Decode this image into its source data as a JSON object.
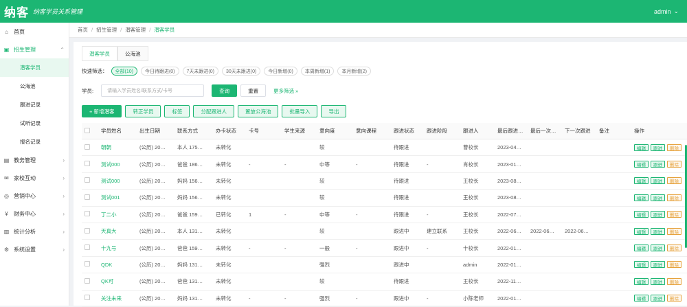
{
  "header": {
    "logo": "纳客",
    "slogan": "纳客学员关系管理",
    "user": "admin"
  },
  "sidebar": {
    "items": [
      {
        "label": "首页",
        "icon": "home-icon",
        "glyph": "⌂"
      },
      {
        "label": "招生管理",
        "icon": "enroll-icon",
        "glyph": "▣",
        "expanded": true,
        "children": [
          "潜客学员",
          "公海池",
          "跟进记录",
          "试听记录",
          "报名记录"
        ]
      },
      {
        "label": "教务管理",
        "icon": "book-icon",
        "glyph": "▤"
      },
      {
        "label": "家校互动",
        "icon": "chat-icon",
        "glyph": "✉"
      },
      {
        "label": "营销中心",
        "icon": "marketing-icon",
        "glyph": "◎"
      },
      {
        "label": "财务中心",
        "icon": "finance-icon",
        "glyph": "¥"
      },
      {
        "label": "统计分析",
        "icon": "chart-icon",
        "glyph": "▥"
      },
      {
        "label": "系统设置",
        "icon": "settings-icon",
        "glyph": "⚙"
      }
    ]
  },
  "breadcrumb": [
    "首页",
    "招生管理",
    "潜客管理",
    "潜客学员"
  ],
  "tabs": [
    "潜客学员",
    "公海池"
  ],
  "filter": {
    "label": "快速筛选：",
    "chips": [
      "全部(10)",
      "今日待跟进(0)",
      "7天未跟进(0)",
      "30天未跟进(0)",
      "今日新增(0)",
      "本周新增(1)",
      "本月新增(2)"
    ]
  },
  "search": {
    "label": "学员:",
    "placeholder": "请输入学员姓名/联系方式/卡号",
    "query_button": "查询",
    "reset_button": "重置",
    "more_link": "更多筛选 »"
  },
  "actions": [
    "+ 新增潜客",
    "转正学员",
    "标签",
    "分配跟进人",
    "置放公海池",
    "批量导入",
    "导出"
  ],
  "table": {
    "columns": [
      "学员姓名",
      "出生日期",
      "联系方式",
      "办卡状态",
      "卡号",
      "学生来源",
      "意向度",
      "意向课程",
      "跟进状态",
      "跟进阶段",
      "跟进人",
      "最后跟进…",
      "最后一次…",
      "下一次跟进",
      "备注",
      "操作"
    ],
    "ops": [
      "编辑",
      "跟进",
      "删除"
    ],
    "rows": [
      [
        "朝朝",
        "(公历) 20…",
        "本人 175…",
        "未转化",
        "",
        "",
        "较",
        "",
        "待跟进",
        "",
        "曹校长",
        "2023-04…",
        "",
        "",
        ""
      ],
      [
        "测试000",
        "(公历) 20…",
        "爸爸 186…",
        "未转化",
        "-",
        "-",
        "中等",
        "-",
        "待跟进",
        "-",
        "肖校长",
        "2023-01…",
        "",
        "",
        ""
      ],
      [
        "测试000",
        "(公历) 20…",
        "妈妈 156…",
        "未转化",
        "",
        "",
        "较",
        "",
        "待跟进",
        "",
        "王校长",
        "2023-08…",
        "",
        "",
        ""
      ],
      [
        "测试001",
        "(公历) 20…",
        "妈妈 156…",
        "未转化",
        "",
        "",
        "较",
        "",
        "待跟进",
        "",
        "王校长",
        "2023-08…",
        "",
        "",
        ""
      ],
      [
        "丁二小",
        "(公历) 20…",
        "爸爸 159…",
        "已转化",
        "1",
        "-",
        "中等",
        "-",
        "待跟进",
        "-",
        "王校长",
        "2022-07…",
        "",
        "",
        ""
      ],
      [
        "天真大",
        "(公历) 20…",
        "本人 131…",
        "未转化",
        "",
        "",
        "较",
        "",
        "跟进中",
        "建立联系",
        "王校长",
        "2022-06…",
        "2022-06…",
        "2022-06…",
        ""
      ],
      [
        "十九号",
        "(公历) 20…",
        "爸爸 159…",
        "未转化",
        "-",
        "-",
        "一般",
        "-",
        "跟进中",
        "-",
        "十校长",
        "2022-01…",
        "",
        "",
        ""
      ],
      [
        "QDK",
        "(公历) 20…",
        "妈妈 131…",
        "未转化",
        "",
        "",
        "强烈",
        "",
        "跟进中",
        "",
        "admin",
        "2022-01…",
        "",
        "",
        ""
      ],
      [
        "QK可",
        "(公历) 20…",
        "爸爸 131…",
        "未转化",
        "",
        "",
        "较",
        "",
        "待跟进",
        "",
        "王校长",
        "2022-11…",
        "",
        "",
        ""
      ],
      [
        "关注未来",
        "(公历) 20…",
        "妈妈 131…",
        "未转化",
        "-",
        "-",
        "强烈",
        "-",
        "跟进中",
        "-",
        "小陈老师",
        "2022-01…",
        "",
        "",
        ""
      ]
    ]
  },
  "colors": {
    "accent": "#1cb673",
    "warning": "#e6a23c"
  }
}
